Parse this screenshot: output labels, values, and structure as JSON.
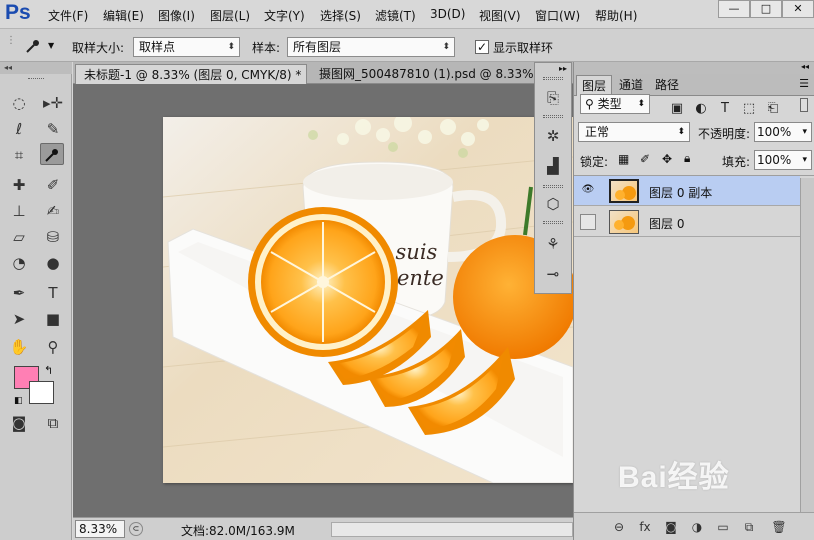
{
  "app": {
    "logo": "Ps"
  },
  "menu": [
    "文件(F)",
    "编辑(E)",
    "图像(I)",
    "图层(L)",
    "文字(Y)",
    "选择(S)",
    "滤镜(T)",
    "3D(D)",
    "视图(V)",
    "窗口(W)",
    "帮助(H)"
  ],
  "window_controls": {
    "minimize": "—",
    "maximize": "□",
    "close": "✕"
  },
  "options": {
    "sample_size_label": "取样大小:",
    "sample_size_value": "取样点",
    "sample_label": "样本:",
    "sample_value": "所有图层",
    "show_ring_label": "显示取样环",
    "show_ring_checked": true
  },
  "doc_tabs": [
    {
      "label": "未标题-1 @ 8.33% (图层 0, CMYK/8) *",
      "close": "×",
      "active": true
    },
    {
      "label": "摄图网_500487810 (1).psd @ 8.33% (图",
      "active": false
    }
  ],
  "canvas_text": {
    "cup_line1": "Je suis",
    "cup_line2": "ntente"
  },
  "status": {
    "zoom": "8.33%",
    "doc_info": "文档:82.0M/163.9M"
  },
  "layers_panel": {
    "tabs": [
      "图层",
      "通道",
      "路径"
    ],
    "filter_kind": "类型",
    "blend_mode": "正常",
    "opacity_label": "不透明度:",
    "opacity_value": "100%",
    "lock_label": "锁定:",
    "fill_label": "填充:",
    "fill_value": "100%",
    "layers": [
      {
        "name": "图层 0 副本",
        "visible": true,
        "selected": true
      },
      {
        "name": "图层 0",
        "visible": false,
        "selected": false
      }
    ]
  },
  "watermark": "Bai经验",
  "colors": {
    "foreground": "#ff7fb4",
    "background": "#ffffff",
    "selection": "#b9cdf2"
  }
}
